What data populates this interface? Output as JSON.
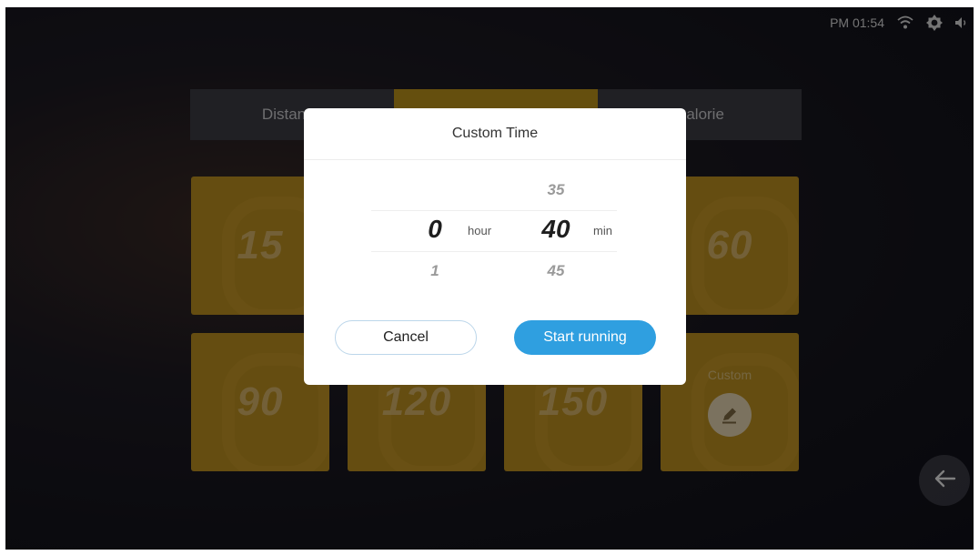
{
  "status_bar": {
    "time": "PM 01:54",
    "icons": [
      "wifi-icon",
      "brightness-icon",
      "volume-icon"
    ]
  },
  "tabs": [
    {
      "label": "Distance",
      "active": false
    },
    {
      "label": "",
      "active": true
    },
    {
      "label": "Calorie",
      "active": false
    }
  ],
  "tiles": [
    {
      "value": "15"
    },
    {
      "value": ""
    },
    {
      "value": ""
    },
    {
      "value": "60"
    },
    {
      "value": "90"
    },
    {
      "value": "120"
    },
    {
      "value": "150"
    },
    {
      "value": ""
    }
  ],
  "custom_tile": {
    "label": "Custom",
    "icon": "pencil-icon"
  },
  "dialog": {
    "title": "Custom Time",
    "hour_picker": {
      "above": "",
      "selected": "0",
      "below": "1",
      "unit": "hour"
    },
    "min_picker": {
      "above": "35",
      "selected": "40",
      "below": "45",
      "unit": "min"
    },
    "cancel_label": "Cancel",
    "start_label": "Start running"
  },
  "colors": {
    "accent": "#2f9fe0",
    "tile": "#b98d1f",
    "active_tab": "#b9901a"
  }
}
